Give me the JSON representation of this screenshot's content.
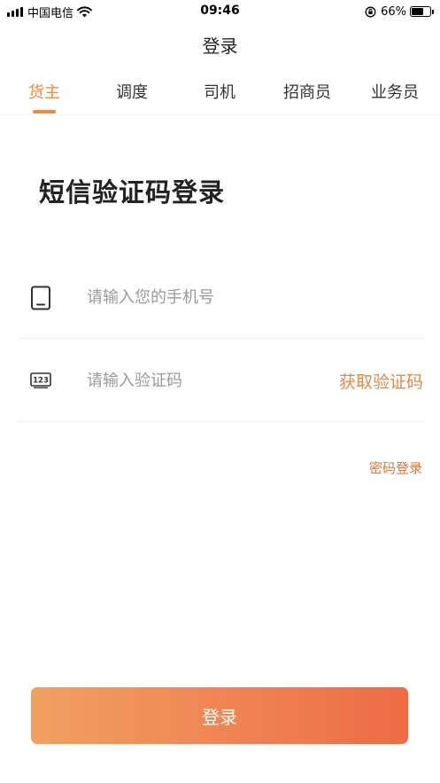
{
  "status_bar": {
    "carrier": "中国电信",
    "time": "09:46",
    "battery": "66%",
    "battery_level": 0.66
  },
  "nav": {
    "title": "登录"
  },
  "tabs": [
    {
      "label": "货主",
      "active": true
    },
    {
      "label": "调度",
      "active": false
    },
    {
      "label": "司机",
      "active": false
    },
    {
      "label": "招商员",
      "active": false
    },
    {
      "label": "业务员",
      "active": false
    }
  ],
  "heading": "短信验证码登录",
  "form": {
    "phone": {
      "placeholder": "请输入您的手机号",
      "value": "",
      "icon": "phone-icon"
    },
    "code": {
      "placeholder": "请输入验证码",
      "value": "",
      "icon": "keypad-123-icon",
      "get_code_label": "获取验证码",
      "icon_text": "123"
    }
  },
  "password_login_link": "密码登录",
  "login_button": "登录",
  "colors": {
    "accent": "#ee8a45",
    "link": "#e0753f",
    "button_gradient_start": "#f1a062",
    "button_gradient_end": "#ee6b45"
  }
}
